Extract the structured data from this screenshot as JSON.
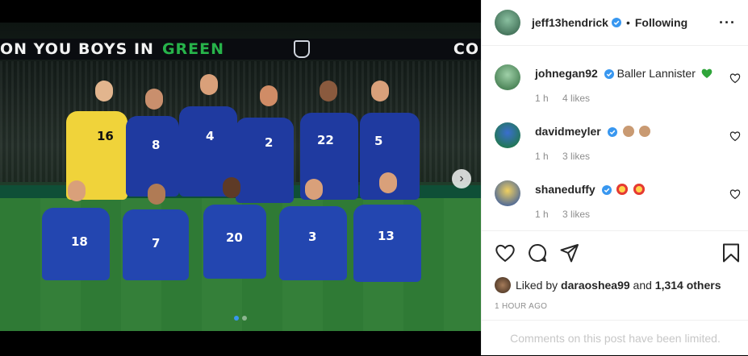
{
  "post": {
    "banner_text": "ON YOU BOYS IN",
    "banner_green": "GREEN",
    "banner_right": "CO",
    "jersey_numbers_back": [
      "16",
      "8",
      "4",
      "2",
      "22",
      "5"
    ],
    "jersey_numbers_front": [
      "18",
      "7",
      "20",
      "3",
      "13"
    ],
    "carousel_next": "›"
  },
  "header": {
    "username": "jeff13hendrick",
    "separator": "•",
    "follow_status": "Following",
    "more": "···"
  },
  "comments": [
    {
      "user": "johnegan92",
      "text": "Baller Lannister",
      "time": "1 h",
      "likes": "4 likes",
      "emoji": [
        "green-heart"
      ]
    },
    {
      "user": "davidmeyler",
      "text": "",
      "time": "1 h",
      "likes": "3 likes",
      "emoji": [
        "clapping-hands",
        "clapping-hands"
      ]
    },
    {
      "user": "shaneduffy",
      "text": "",
      "time": "1 h",
      "likes": "3 likes",
      "emoji": [
        "star-struck",
        "star-struck"
      ]
    }
  ],
  "likes": {
    "prefix": "Liked by",
    "user": "daraoshea99",
    "mid": "and",
    "count": "1,314 others"
  },
  "timestamp": "1 HOUR AGO",
  "limited_text": "Comments on this post have been limited.",
  "colors": {
    "verified": "#3897f0",
    "green": "#27b34a",
    "muted": "#8e8e8e"
  }
}
